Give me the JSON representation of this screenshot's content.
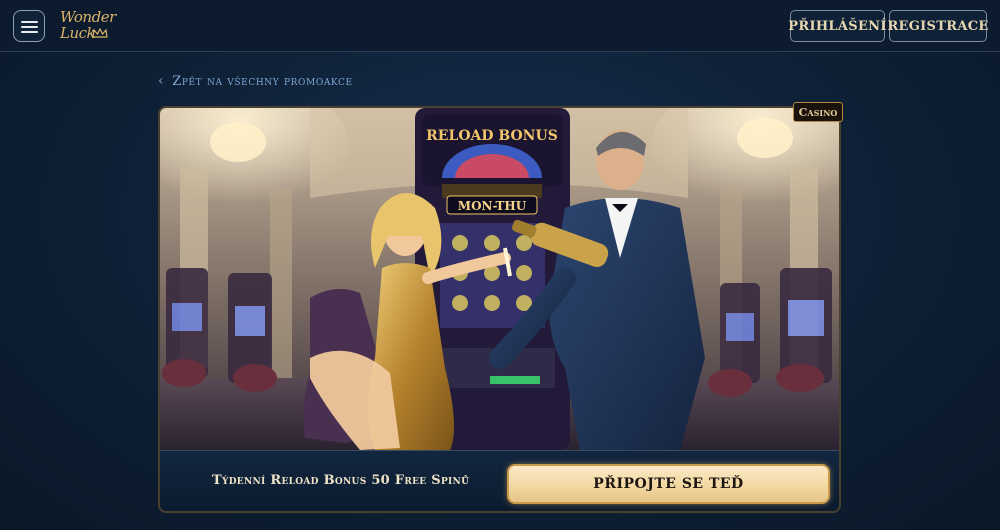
{
  "header": {
    "logo_line1": "Wonder",
    "logo_line2": "Luck",
    "login_label": "PŘIHLÁŠENÍ",
    "register_label": "REGISTRACE"
  },
  "back_link": {
    "label": "Zpět na všechny promoakce"
  },
  "promo": {
    "badge": "Casino",
    "banner": {
      "machine_title": "RELOAD BONUS",
      "machine_days": "MON-THU"
    },
    "title": "Týdenní Reload Bonus 50 Free Spinů",
    "cta_label": "PŘIPOJTE SE TEĎ"
  },
  "colors": {
    "accent_gold": "#d9b36a",
    "cta_gold": "#f2d8a2",
    "link_blue": "#7fa6d6",
    "background": "#0f2238"
  },
  "icons": {
    "menu": "hamburger-icon",
    "back": "chevron-left-icon",
    "logo_crown": "crown-icon"
  }
}
